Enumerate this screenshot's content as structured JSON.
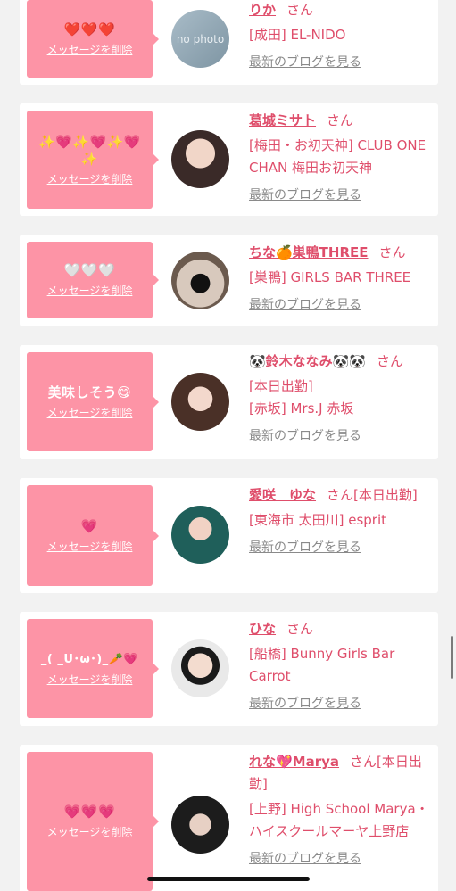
{
  "delete_label": "メッセージを削除",
  "blog_label": "最新のブログを見る",
  "san": "さん",
  "colors": {
    "accent": "#df4e6b",
    "bubble": "#fd94a6",
    "background": "#f2f2f2"
  },
  "items": [
    {
      "message": "❤️❤️❤️",
      "name": "りか",
      "suffix": "",
      "shop": "[成田] EL-NIDO",
      "avatar_text": "no photo"
    },
    {
      "message": "✨💗✨💗✨💗✨",
      "name": "葛城ミサト",
      "suffix": "",
      "shop": "[梅田・お初天神] CLUB ONE CHAN 梅田お初天神",
      "avatar_text": ""
    },
    {
      "message": "🤍🤍🤍",
      "name": "ちな🍊巣鴨THREE",
      "suffix": "",
      "shop": "[巣鴨] GIRLS BAR THREE",
      "avatar_text": ""
    },
    {
      "message": "美味しそう😋",
      "name": "🐼鈴木ななみ🐼🐼",
      "suffix": "",
      "status": "[本日出勤]",
      "shop": "[赤坂] Mrs.J 赤坂",
      "avatar_text": ""
    },
    {
      "message": "💗",
      "name": "愛咲　ゆな",
      "suffix": "[本日出勤]",
      "shop": "[東海市 太田川] esprit",
      "avatar_text": ""
    },
    {
      "message": "_( _U･ω･)_🥕💗",
      "name": "ひな",
      "suffix": "",
      "shop": "[船橋] Bunny Girls Bar Carrot",
      "avatar_text": ""
    },
    {
      "message": "💗💗💗",
      "name": "れな💖Marya",
      "suffix": "[本日出勤]",
      "shop": "[上野] High School Marya・ハイスクールマーヤ上野店",
      "avatar_text": ""
    }
  ]
}
